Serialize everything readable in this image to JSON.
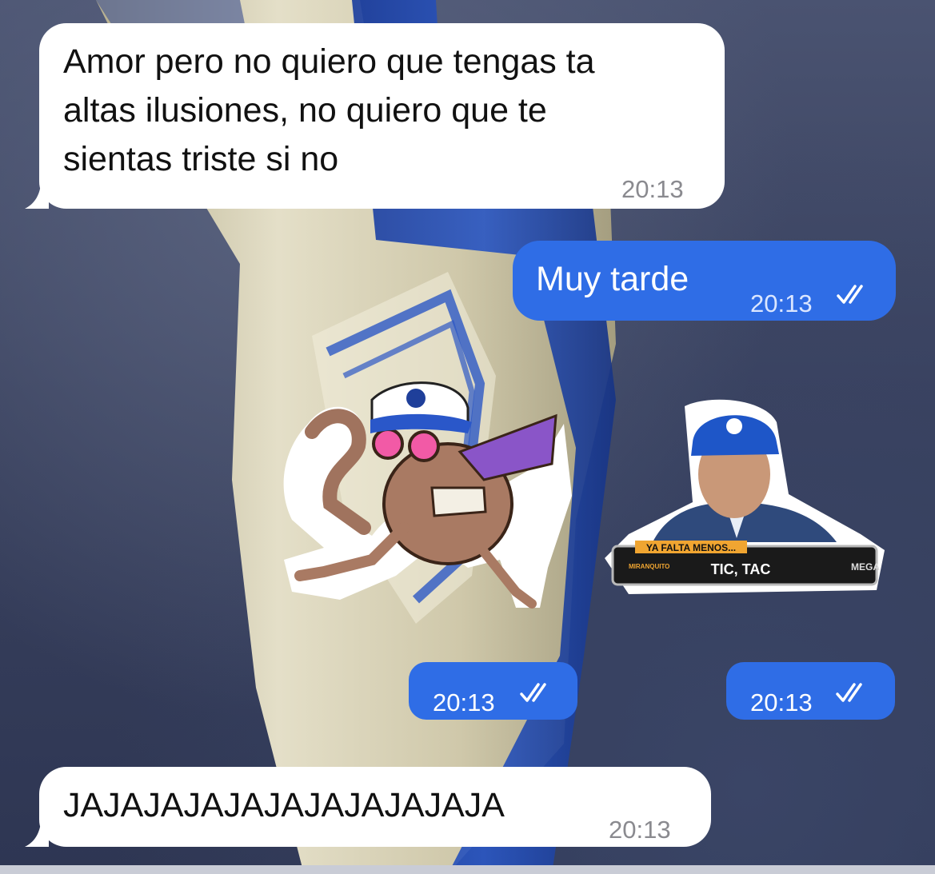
{
  "chat": {
    "messages": [
      {
        "direction": "incoming",
        "text": "Amor pero no quiero que tengas ta\naltas ilusiones, no quiero que te\nsientas triste si no",
        "time": "20:13"
      },
      {
        "direction": "outgoing",
        "text": "Muy tarde",
        "time": "20:13",
        "status_icon": "double-check-icon"
      },
      {
        "direction": "outgoing",
        "type": "sticker",
        "sticker": "cartoon-mosquito-cap-sticker",
        "time": "20:13",
        "status_icon": "double-check-icon"
      },
      {
        "direction": "outgoing",
        "type": "sticker",
        "sticker": "tv-presenter-cap-sticker",
        "caption_top": "YA FALTA MENOS...",
        "caption_main": "TIC, TAC",
        "logo_left": "MIRANQUITO",
        "logo_right": "MEGA",
        "time": "20:13",
        "status_icon": "double-check-icon"
      },
      {
        "direction": "incoming",
        "text": "JAJAJAJAJAJAJAJAJAJAJA",
        "time": "20:13"
      }
    ]
  },
  "colors": {
    "incoming_bubble": "#ffffff",
    "outgoing_bubble": "#2f6de6",
    "wallpaper": "#39415e"
  }
}
